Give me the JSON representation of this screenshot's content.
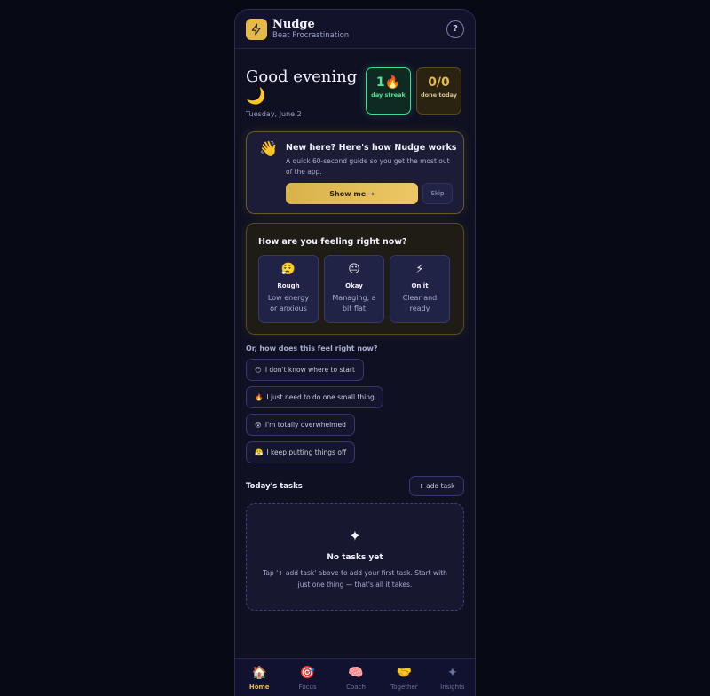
{
  "header": {
    "app_name": "Nudge",
    "tagline": "Beat Procrastination",
    "help_label": "?"
  },
  "greeting": {
    "text": "Good evening 🌙",
    "date": "Tuesday, June 2"
  },
  "stats": {
    "streak_value": "1🔥",
    "streak_label": "day streak",
    "done_value": "0/0",
    "done_label": "done today"
  },
  "guide": {
    "icon": "👋",
    "title": "New here? Here's how Nudge works",
    "text": "A quick 60-second guide so you get the most out of the app.",
    "show_label": "Show me →",
    "skip_label": "Skip"
  },
  "feeling": {
    "title": "How are you feeling right now?",
    "options": [
      {
        "emoji": "😮‍💨",
        "name": "Rough",
        "desc": "Low energy or anxious"
      },
      {
        "emoji": "😐",
        "name": "Okay",
        "desc": "Managing, a bit flat"
      },
      {
        "emoji": "⚡",
        "name": "On it",
        "desc": "Clear and ready"
      }
    ]
  },
  "prompts": {
    "label": "Or, how does this feel right now?",
    "chips": [
      {
        "emoji": "😶",
        "text": "I don't know where to start"
      },
      {
        "emoji": "🔥",
        "text": "I just need to do one small thing"
      },
      {
        "emoji": "😰",
        "text": "I'm totally overwhelmed"
      },
      {
        "emoji": "😤",
        "text": "I keep putting things off"
      }
    ]
  },
  "tasks": {
    "title": "Today's tasks",
    "add_label": "+ add task",
    "empty_icon": "✦",
    "empty_title": "No tasks yet",
    "empty_text": "Tap '+ add task' above to add your first task. Start with just one thing — that's all it takes."
  },
  "nav": [
    {
      "icon": "🏠",
      "label": "Home",
      "active": true
    },
    {
      "icon": "🎯",
      "label": "Focus",
      "active": false
    },
    {
      "icon": "🧠",
      "label": "Coach",
      "active": false
    },
    {
      "icon": "🤝",
      "label": "Together",
      "active": false
    },
    {
      "icon": "✦",
      "label": "Insights",
      "active": false
    }
  ],
  "colors": {
    "accent": "#e5b94a",
    "streak_green": "#52e39a",
    "background": "#070914"
  }
}
